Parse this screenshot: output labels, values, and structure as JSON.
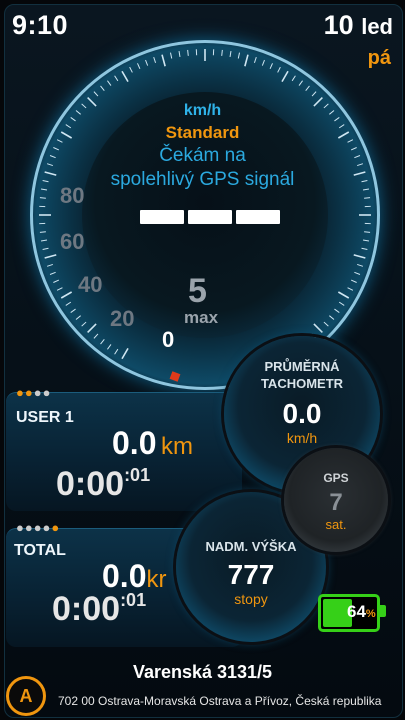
{
  "status": {
    "time": "9:10",
    "day": "10",
    "month": "led",
    "weekday": "pá"
  },
  "speedometer": {
    "unit": "km/h",
    "profile": "Standard",
    "message_line1": "Čekám na",
    "message_line2": "spolehlivý GPS signál",
    "speed_dashes": [
      "",
      "",
      ""
    ],
    "scale_labels": [
      "80",
      "60",
      "40",
      "20"
    ],
    "current_marker": "0",
    "max_value": "5",
    "max_label": "max"
  },
  "user1": {
    "dots": "●●●●",
    "label": "USER 1",
    "distance": "0.0",
    "distance_unit": "km",
    "time_main": "0:00",
    "time_sup": ":01"
  },
  "total": {
    "dots": "●●●●●",
    "label": "TOTAL",
    "distance": "0.0",
    "distance_unit": "kr",
    "time_main": "0:00",
    "time_sup": ":01"
  },
  "avg_speed": {
    "title_line1": "PRŮMĚRNÁ",
    "title_line2": "TACHOMETR",
    "value": "0.0",
    "unit": "km/h"
  },
  "gps": {
    "title": "GPS",
    "value": "7",
    "unit": "sat."
  },
  "altitude": {
    "title": "NADM. VÝŠKA",
    "value": "777",
    "unit": "stopy"
  },
  "battery": {
    "percent": "64",
    "percent_sign": "%",
    "level": 0.64
  },
  "address": {
    "street": "Varenská 3131/5",
    "city": "702 00 Ostrava-Moravská Ostrava a Přívoz, Česká republika",
    "button": "A"
  },
  "colors": {
    "accent": "#f0960f",
    "blue": "#2fb2e8",
    "battery": "#36d018"
  }
}
